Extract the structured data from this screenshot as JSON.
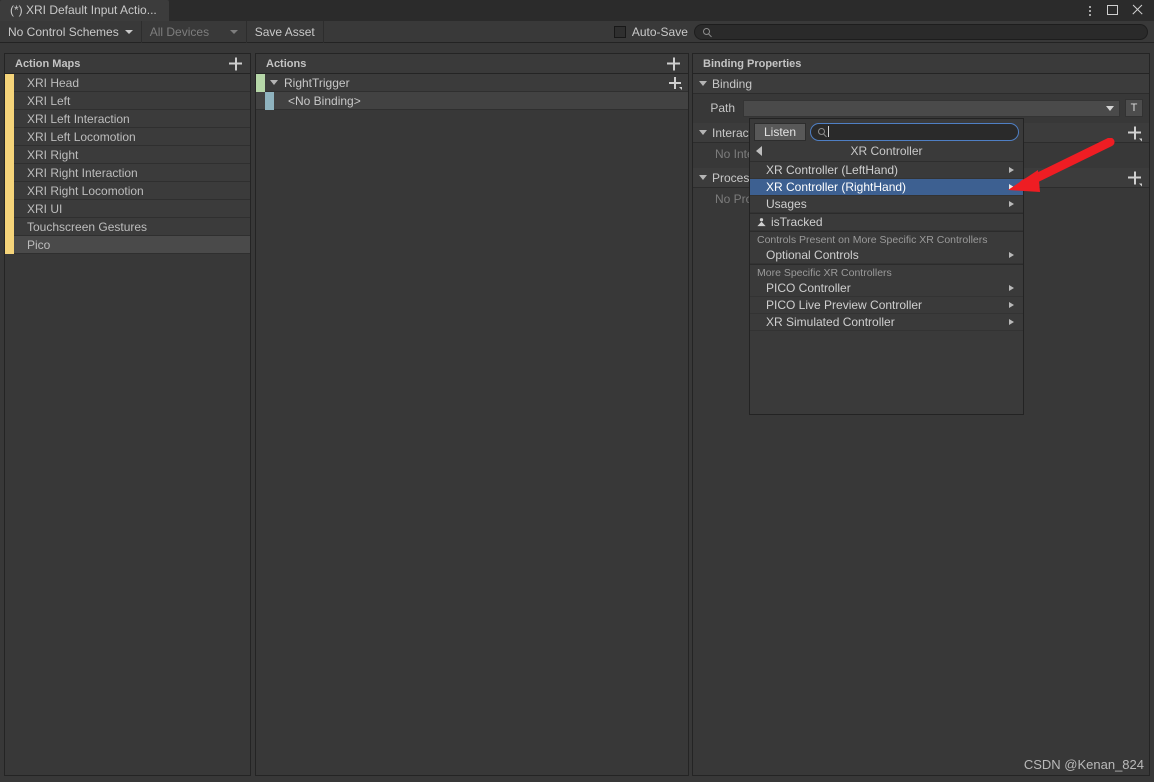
{
  "window": {
    "tab_title": "(*) XRI Default Input Actio...",
    "buttons": {
      "menu": "kebab-menu",
      "maximize": "maximize",
      "close": "close"
    }
  },
  "toolbar": {
    "control_schemes": "No Control Schemes",
    "devices": "All Devices",
    "save_asset": "Save Asset",
    "auto_save": "Auto-Save",
    "search_placeholder": "",
    "search_value": ""
  },
  "action_maps": {
    "header": "Action Maps",
    "add_label": "+",
    "items": [
      {
        "label": "XRI Head",
        "selected": false
      },
      {
        "label": "XRI Left",
        "selected": false
      },
      {
        "label": "XRI Left Interaction",
        "selected": false
      },
      {
        "label": "XRI Left Locomotion",
        "selected": false
      },
      {
        "label": "XRI Right",
        "selected": false
      },
      {
        "label": "XRI Right Interaction",
        "selected": false
      },
      {
        "label": "XRI Right Locomotion",
        "selected": false
      },
      {
        "label": "XRI UI",
        "selected": false
      },
      {
        "label": "Touchscreen Gestures",
        "selected": false
      },
      {
        "label": "Pico",
        "selected": true
      }
    ]
  },
  "actions": {
    "header": "Actions",
    "add_label": "+",
    "items": [
      {
        "label": "RightTrigger",
        "type": "action",
        "expanded": true,
        "selected": false
      },
      {
        "label": "<No Binding>",
        "type": "binding",
        "selected": true
      }
    ]
  },
  "binding_properties": {
    "header": "Binding Properties",
    "binding_section": "Binding",
    "path_label": "Path",
    "path_value": "",
    "path_text_button": "T",
    "interactions_section": "Interactions",
    "interactions_empty": "No Interactions have been added.",
    "processors_section": "Processors",
    "processors_empty": "No Processors have been added."
  },
  "path_popup": {
    "listen_button": "Listen",
    "search_value": "",
    "search_placeholder": "",
    "breadcrumb_title": "XR Controller",
    "groups": [
      {
        "header": null,
        "items": [
          {
            "label": "XR Controller (LeftHand)",
            "submenu": true,
            "selected": false
          },
          {
            "label": "XR Controller (RightHand)",
            "submenu": true,
            "selected": true
          },
          {
            "label": "Usages",
            "submenu": true,
            "selected": false
          }
        ]
      },
      {
        "header": null,
        "items": [
          {
            "label": "isTracked",
            "submenu": false,
            "selected": false,
            "icon": "person-icon"
          }
        ]
      },
      {
        "header": "Controls Present on More Specific XR Controllers",
        "items": [
          {
            "label": "Optional Controls",
            "submenu": true,
            "selected": false
          }
        ]
      },
      {
        "header": "More Specific XR Controllers",
        "items": [
          {
            "label": "PICO Controller",
            "submenu": true,
            "selected": false
          },
          {
            "label": "PICO Live Preview Controller",
            "submenu": true,
            "selected": false
          },
          {
            "label": "XR Simulated Controller",
            "submenu": true,
            "selected": false
          }
        ]
      }
    ]
  },
  "annotation": {
    "arrow_color": "#ee1d23"
  },
  "watermark": "CSDN @Kenan_824",
  "colors": {
    "background": "#383838",
    "panel_header": "#3a3a3a",
    "selection_blue": "#3d6091",
    "action_map_bar": "#f5d47a",
    "action_bar": "#b6d7a8",
    "binding_bar": "#8fb3bf"
  }
}
